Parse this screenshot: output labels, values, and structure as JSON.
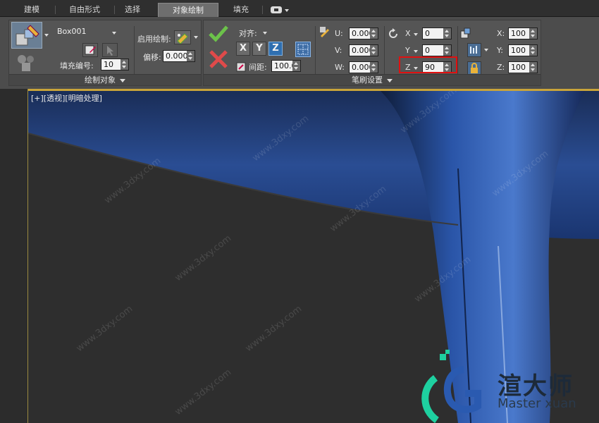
{
  "tabs": [
    {
      "label": "建模",
      "active": false
    },
    {
      "label": "自由形式",
      "active": false
    },
    {
      "label": "选择",
      "active": false
    },
    {
      "label": "对象绘制",
      "active": true
    },
    {
      "label": "填充",
      "active": false
    }
  ],
  "paint_objects": {
    "object_name": "Box001",
    "fill_number_label": "填充编号:",
    "fill_number_value": "10",
    "footer": "绘制对象"
  },
  "enable_paint": {
    "enable_label": "启用绘制:",
    "offset_label": "偏移:",
    "offset_value": "0.000"
  },
  "brush": {
    "align_label": "对齐:",
    "axes": [
      "X",
      "Y",
      "Z"
    ],
    "active_axis": "Z",
    "spacing_label": "间距:",
    "spacing_value": "100.0",
    "u_label": "U:",
    "u_value": "0.000",
    "v_label": "V:",
    "v_value": "0.000",
    "w_label": "W:",
    "w_value": "0.000",
    "rx_label": "X",
    "rx_value": "0",
    "ry_label": "Y",
    "ry_value": "0",
    "rz_label": "Z",
    "rz_value": "90",
    "sx_label": "X:",
    "sx_value": "100",
    "sy_label": "Y:",
    "sy_value": "100",
    "sz_label": "Z:",
    "sz_value": "100",
    "footer": "笔刷设置"
  },
  "viewport": {
    "label": "[+][透视][明暗处理]"
  },
  "watermark": {
    "site": "www.3dxy.com",
    "brand": "渲大师",
    "brand_en": "Master xuan"
  },
  "colors": {
    "accent": "#2f6fb0",
    "highlight_box": "#e01010",
    "viewport_border": "#c9a43a",
    "mesh_blue": "#2d5aa8"
  }
}
